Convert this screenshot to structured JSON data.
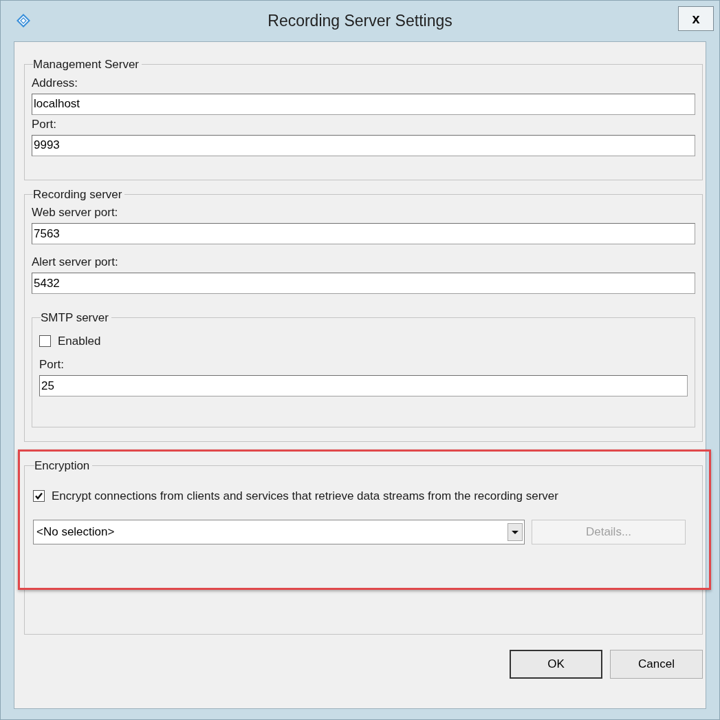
{
  "window": {
    "title": "Recording Server Settings",
    "close": "x"
  },
  "management_server": {
    "title": "Management Server",
    "fields": [
      {
        "label": "Address:",
        "value": "localhost"
      },
      {
        "label": "Port:",
        "value": "9993"
      }
    ]
  },
  "recording_server": {
    "title": "Recording server",
    "fields": [
      {
        "label": "Web server port:",
        "value": "7563"
      },
      {
        "label": "Alert server port:",
        "value": "5432"
      }
    ],
    "smtp_server": {
      "title": "SMTP server",
      "enabled": {
        "label": "Enabled",
        "checked": false
      },
      "fields": [
        {
          "label": "Port:",
          "value": "25"
        }
      ]
    }
  },
  "encryption": {
    "title": "Encryption",
    "encrypt": {
      "label": "Encrypt connections from clients and services that retrieve data streams from the recording server",
      "checked": true
    },
    "certificate": {
      "value": "<No selection>"
    },
    "details_button": {
      "label": "Details...",
      "disabled": true
    }
  },
  "buttons": [
    {
      "label": "OK",
      "default": true
    },
    {
      "label": "Cancel",
      "default": false
    }
  ]
}
